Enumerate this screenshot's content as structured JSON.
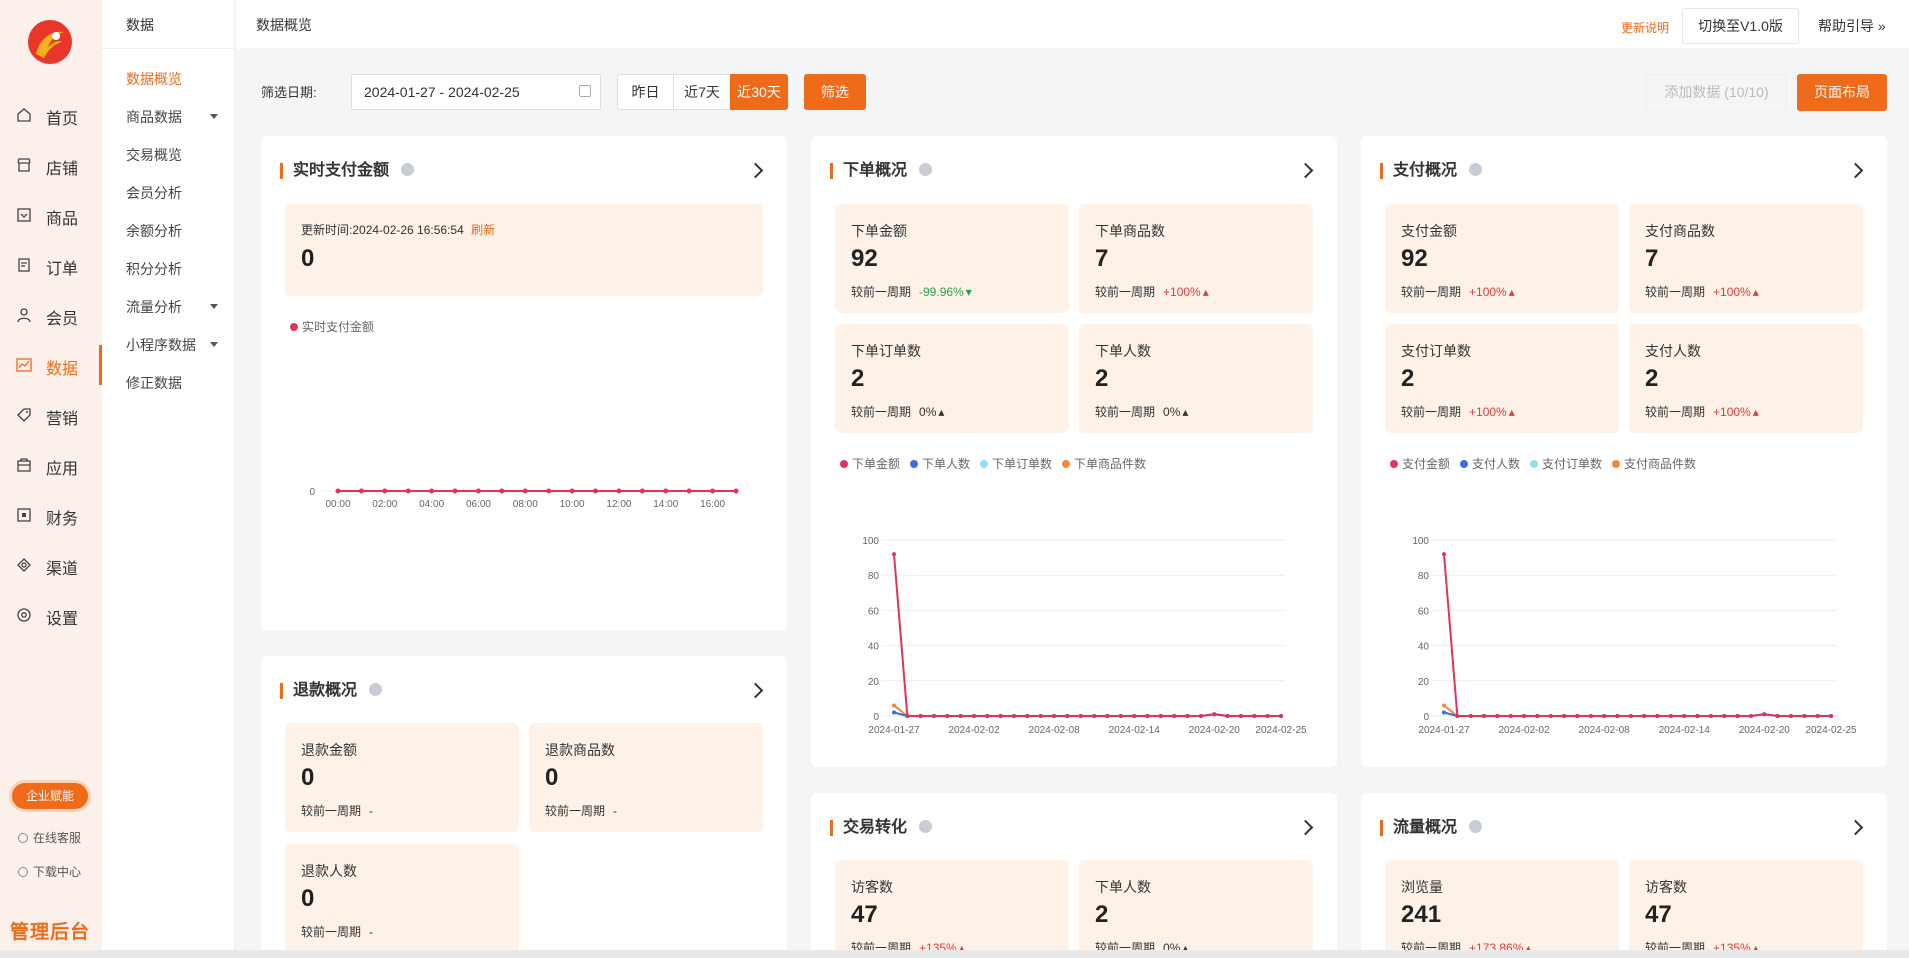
{
  "app": {
    "brand": "管理后台"
  },
  "sidebar": {
    "items": [
      {
        "label": "首页",
        "icon": "home-icon"
      },
      {
        "label": "店铺",
        "icon": "shop-icon"
      },
      {
        "label": "商品",
        "icon": "goods-icon"
      },
      {
        "label": "订单",
        "icon": "order-icon"
      },
      {
        "label": "会员",
        "icon": "user-icon"
      },
      {
        "label": "数据",
        "icon": "chart-icon",
        "active": true
      },
      {
        "label": "营销",
        "icon": "tag-icon"
      },
      {
        "label": "应用",
        "icon": "app-icon"
      },
      {
        "label": "财务",
        "icon": "finance-icon"
      },
      {
        "label": "渠道",
        "icon": "channel-icon"
      },
      {
        "label": "设置",
        "icon": "gear-icon"
      }
    ],
    "enterprise_label": "企业赋能",
    "online_service": "在线客服",
    "download_center": "下载中心"
  },
  "subnav": {
    "title": "数据",
    "items": [
      {
        "label": "数据概览",
        "active": true
      },
      {
        "label": "商品数据",
        "caret": true
      },
      {
        "label": "交易概览"
      },
      {
        "label": "会员分析"
      },
      {
        "label": "余额分析"
      },
      {
        "label": "积分分析"
      },
      {
        "label": "流量分析",
        "caret": true
      },
      {
        "label": "小程序数据",
        "caret": true
      },
      {
        "label": "修正数据"
      }
    ]
  },
  "topbar": {
    "breadcrumb": "数据概览",
    "update_notes": "更新说明",
    "switch_version": "切换至V1.0版",
    "help": "帮助引导"
  },
  "filter": {
    "label": "筛选日期:",
    "date_range": "2024-01-27 - 2024-02-25",
    "ranges": [
      "昨日",
      "近7天",
      "近30天"
    ],
    "active_range": "近30天",
    "filter_button": "筛选",
    "add_data_button": "添加数据 (10/10)",
    "page_layout_button": "页面布局"
  },
  "colors": {
    "accent": "#ef6a19",
    "red": "#e0355a",
    "blue": "#3f6fd8",
    "cyan": "#8fdfe8",
    "orange": "#f0883e"
  },
  "cards": {
    "realtime": {
      "title": "实时支付金额",
      "update_prefix": "更新时间:",
      "update_time": "2024-02-26 16:56:54",
      "refresh": "刷新",
      "value": "0",
      "legend": "实时支付金额"
    },
    "orders": {
      "title": "下单概况",
      "metrics": [
        {
          "label": "下单金额",
          "value": "92",
          "cmp": "较前一周期",
          "change": "-99.96%",
          "dir": "down"
        },
        {
          "label": "下单商品数",
          "value": "7",
          "cmp": "较前一周期",
          "change": "+100%",
          "dir": "up"
        },
        {
          "label": "下单订单数",
          "value": "2",
          "cmp": "较前一周期",
          "change": "0%",
          "dir": "flat"
        },
        {
          "label": "下单人数",
          "value": "2",
          "cmp": "较前一周期",
          "change": "0%",
          "dir": "flat"
        }
      ],
      "legend": [
        "下单金额",
        "下单人数",
        "下单订单数",
        "下单商品件数"
      ]
    },
    "payments": {
      "title": "支付概况",
      "metrics": [
        {
          "label": "支付金额",
          "value": "92",
          "cmp": "较前一周期",
          "change": "+100%",
          "dir": "up"
        },
        {
          "label": "支付商品数",
          "value": "7",
          "cmp": "较前一周期",
          "change": "+100%",
          "dir": "up"
        },
        {
          "label": "支付订单数",
          "value": "2",
          "cmp": "较前一周期",
          "change": "+100%",
          "dir": "up"
        },
        {
          "label": "支付人数",
          "value": "2",
          "cmp": "较前一周期",
          "change": "+100%",
          "dir": "up"
        }
      ],
      "legend": [
        "支付金额",
        "支付人数",
        "支付订单数",
        "支付商品件数"
      ]
    },
    "refunds": {
      "title": "退款概况",
      "metrics": [
        {
          "label": "退款金额",
          "value": "0",
          "cmp": "较前一周期",
          "change": "-"
        },
        {
          "label": "退款商品数",
          "value": "0",
          "cmp": "较前一周期",
          "change": "-"
        },
        {
          "label": "退款人数",
          "value": "0",
          "cmp": "较前一周期",
          "change": "-"
        }
      ]
    },
    "conversion": {
      "title": "交易转化",
      "metrics": [
        {
          "label": "访客数",
          "value": "47",
          "cmp": "较前一周期",
          "change": "+135%",
          "dir": "up"
        },
        {
          "label": "下单人数",
          "value": "2",
          "cmp": "较前一周期",
          "change": "0%",
          "dir": "flat"
        }
      ]
    },
    "traffic": {
      "title": "流量概况",
      "metrics": [
        {
          "label": "浏览量",
          "value": "241",
          "cmp": "较前一周期",
          "change": "+173.86%",
          "dir": "up"
        },
        {
          "label": "访客数",
          "value": "47",
          "cmp": "较前一周期",
          "change": "+135%",
          "dir": "up"
        }
      ]
    }
  },
  "chart_data": [
    {
      "type": "line",
      "name": "realtime",
      "x": [
        "00:00",
        "01:00",
        "02:00",
        "03:00",
        "04:00",
        "05:00",
        "06:00",
        "07:00",
        "08:00",
        "09:00",
        "10:00",
        "11:00",
        "12:00",
        "13:00",
        "14:00",
        "15:00",
        "16:00",
        "17:00"
      ],
      "x_ticks": [
        "00:00",
        "02:00",
        "04:00",
        "06:00",
        "08:00",
        "10:00",
        "12:00",
        "14:00",
        "16:00"
      ],
      "series": [
        {
          "name": "实时支付金额",
          "values": [
            0,
            0,
            0,
            0,
            0,
            0,
            0,
            0,
            0,
            0,
            0,
            0,
            0,
            0,
            0,
            0,
            0,
            0
          ]
        }
      ],
      "ylim": [
        0,
        1
      ],
      "y_ticks": [
        0,
        1
      ]
    },
    {
      "type": "line",
      "name": "orders",
      "x_ticks": [
        "2024-01-27",
        "2024-02-02",
        "2024-02-08",
        "2024-02-14",
        "2024-02-20",
        "2024-02-25"
      ],
      "n_points": 30,
      "series": [
        {
          "name": "下单金额",
          "first": 92,
          "spikes": {
            "24": 1
          }
        },
        {
          "name": "下单人数",
          "first": 2,
          "spikes": {
            "24": 1
          }
        },
        {
          "name": "下单订单数",
          "first": 2,
          "spikes": {
            "24": 1
          }
        },
        {
          "name": "下单商品件数",
          "first": 6,
          "spikes": {
            "24": 1
          }
        }
      ],
      "ylim": [
        0,
        100
      ],
      "y_ticks": [
        0,
        20,
        40,
        60,
        80,
        100
      ]
    },
    {
      "type": "line",
      "name": "payments",
      "x_ticks": [
        "2024-01-27",
        "2024-02-02",
        "2024-02-08",
        "2024-02-14",
        "2024-02-20",
        "2024-02-25"
      ],
      "n_points": 30,
      "series": [
        {
          "name": "支付金额",
          "first": 92,
          "spikes": {
            "24": 1
          }
        },
        {
          "name": "支付人数",
          "first": 2,
          "spikes": {
            "24": 1
          }
        },
        {
          "name": "支付订单数",
          "first": 2,
          "spikes": {
            "24": 1
          }
        },
        {
          "name": "支付商品件数",
          "first": 6,
          "spikes": {
            "24": 1
          }
        }
      ],
      "ylim": [
        0,
        100
      ],
      "y_ticks": [
        0,
        20,
        40,
        60,
        80,
        100
      ]
    }
  ]
}
